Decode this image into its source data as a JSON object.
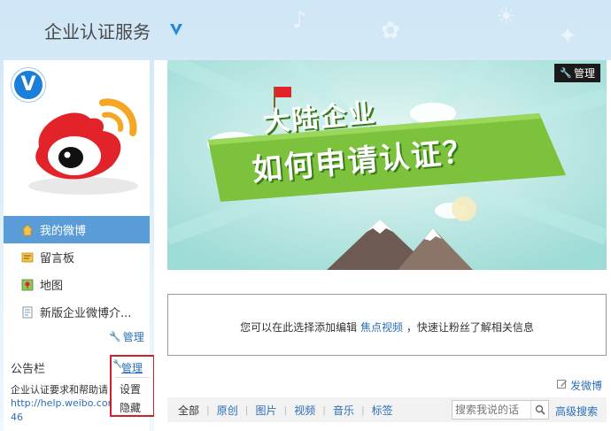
{
  "header": {
    "title": "企业认证服务"
  },
  "sidebar": {
    "nav": [
      {
        "label": "我的微博",
        "icon": "home-icon"
      },
      {
        "label": "留言板",
        "icon": "message-board-icon"
      },
      {
        "label": "地图",
        "icon": "map-icon"
      },
      {
        "label": "新版企业微博介...",
        "icon": "document-icon"
      }
    ],
    "manage_label": "管理",
    "bulletin": {
      "title": "公告栏",
      "manage_label": "管理",
      "text": "企业认证要求和帮助请",
      "link": "http://help.weibo.com/f",
      "link_tail": "46"
    },
    "popup": {
      "manage": "管理",
      "items": [
        "设置",
        "隐藏"
      ]
    }
  },
  "banner": {
    "manage_label": "管理",
    "line1": "大陆企业",
    "line2": "如何申请认证？"
  },
  "video_box": {
    "prefix": "您可以在此选择添加编辑",
    "highlight": "焦点视频",
    "suffix": "，快速让粉丝了解相关信息"
  },
  "post_label": "发微博",
  "filter": {
    "tabs": [
      "全部",
      "原创",
      "图片",
      "视频",
      "音乐",
      "标签"
    ],
    "search_placeholder": "搜索我说的话",
    "advanced_search": "高级搜索"
  },
  "colors": {
    "accent": "#2b6fb6",
    "active_nav": "#5a9cd8",
    "popup_border": "#d0212a"
  }
}
